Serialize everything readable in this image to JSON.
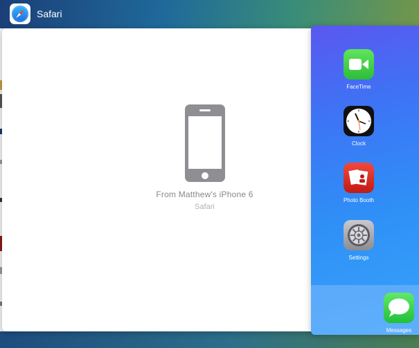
{
  "app_label": {
    "name": "Safari",
    "icon": "safari-compass-icon"
  },
  "handoff": {
    "icon": "iphone-icon",
    "title": "From Matthew's iPhone 6",
    "subtitle": "Safari"
  },
  "switcher": {
    "apps": [
      {
        "label": "FaceTime",
        "icon": "facetime-icon"
      },
      {
        "label": "Clock",
        "icon": "clock-icon"
      },
      {
        "label": "Photo Booth",
        "icon": "photo-booth-icon"
      },
      {
        "label": "Settings",
        "icon": "settings-gear-icon"
      }
    ],
    "dock": [
      {
        "label": "Messages",
        "icon": "messages-bubble-icon"
      }
    ]
  },
  "colors": {
    "switcher_top": "#5b57f0",
    "switcher_bottom": "#38a4f8",
    "handoff_text": "#888888"
  }
}
